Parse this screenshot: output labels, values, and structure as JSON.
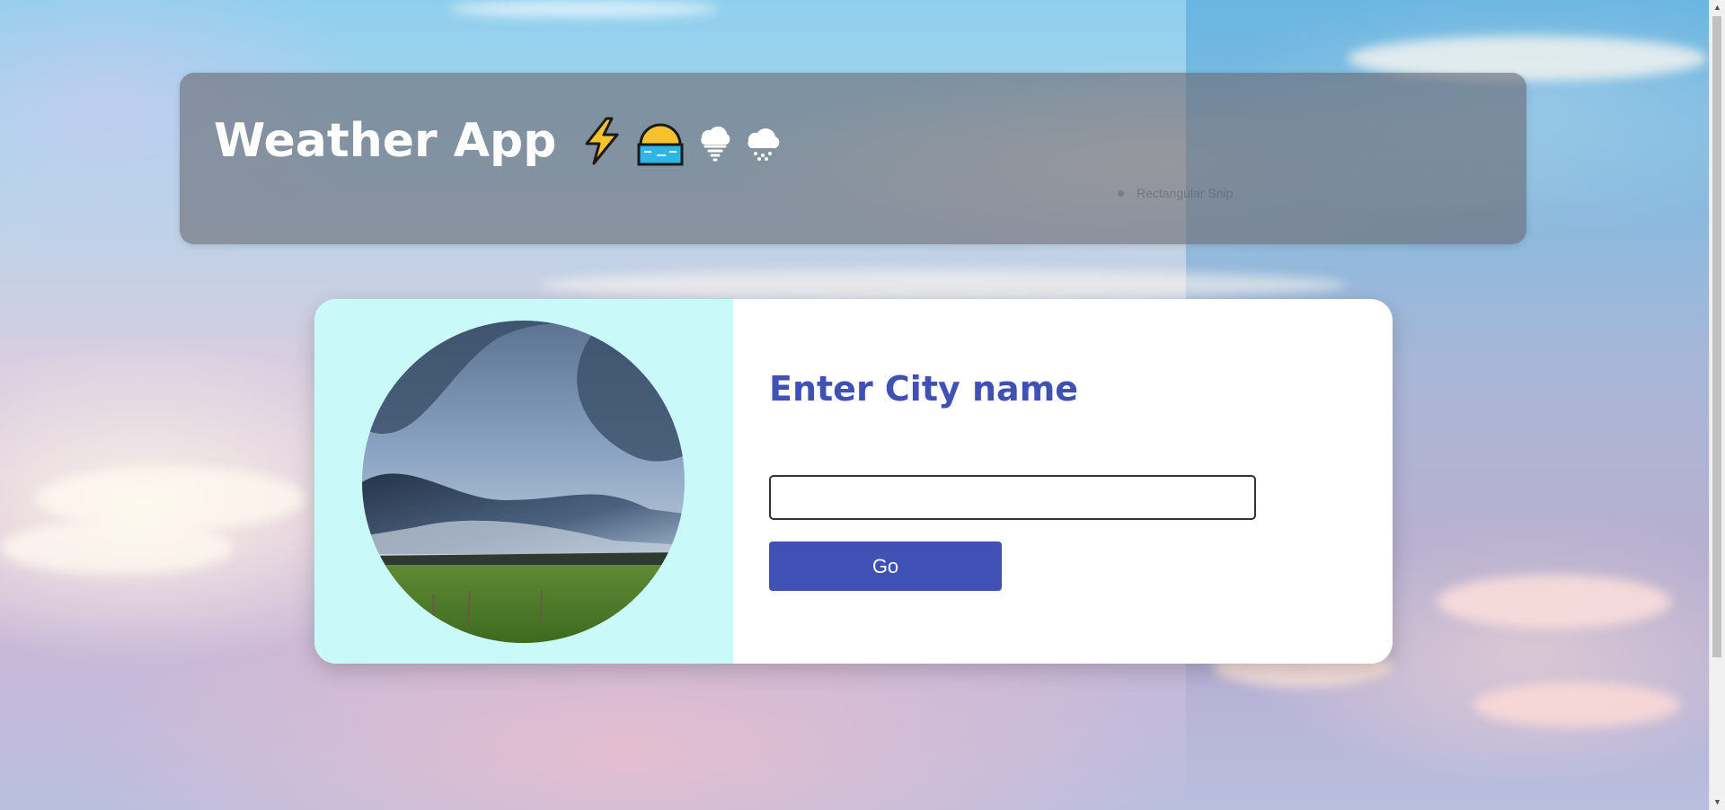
{
  "header": {
    "title": "Weather App",
    "icons": [
      "lightning-icon",
      "sunrise-over-water-icon",
      "tornado-cloud-icon",
      "snow-cloud-icon"
    ],
    "ghost_label": "Rectangular Snip"
  },
  "card": {
    "image_alt": "storm-cloud-over-field-image",
    "prompt": "Enter City name",
    "city_input": {
      "value": "",
      "placeholder": ""
    },
    "go_label": "Go"
  },
  "colors": {
    "accent": "#3f51b5",
    "card_left_bg": "#caf9f9",
    "header_bg": "#696973"
  }
}
